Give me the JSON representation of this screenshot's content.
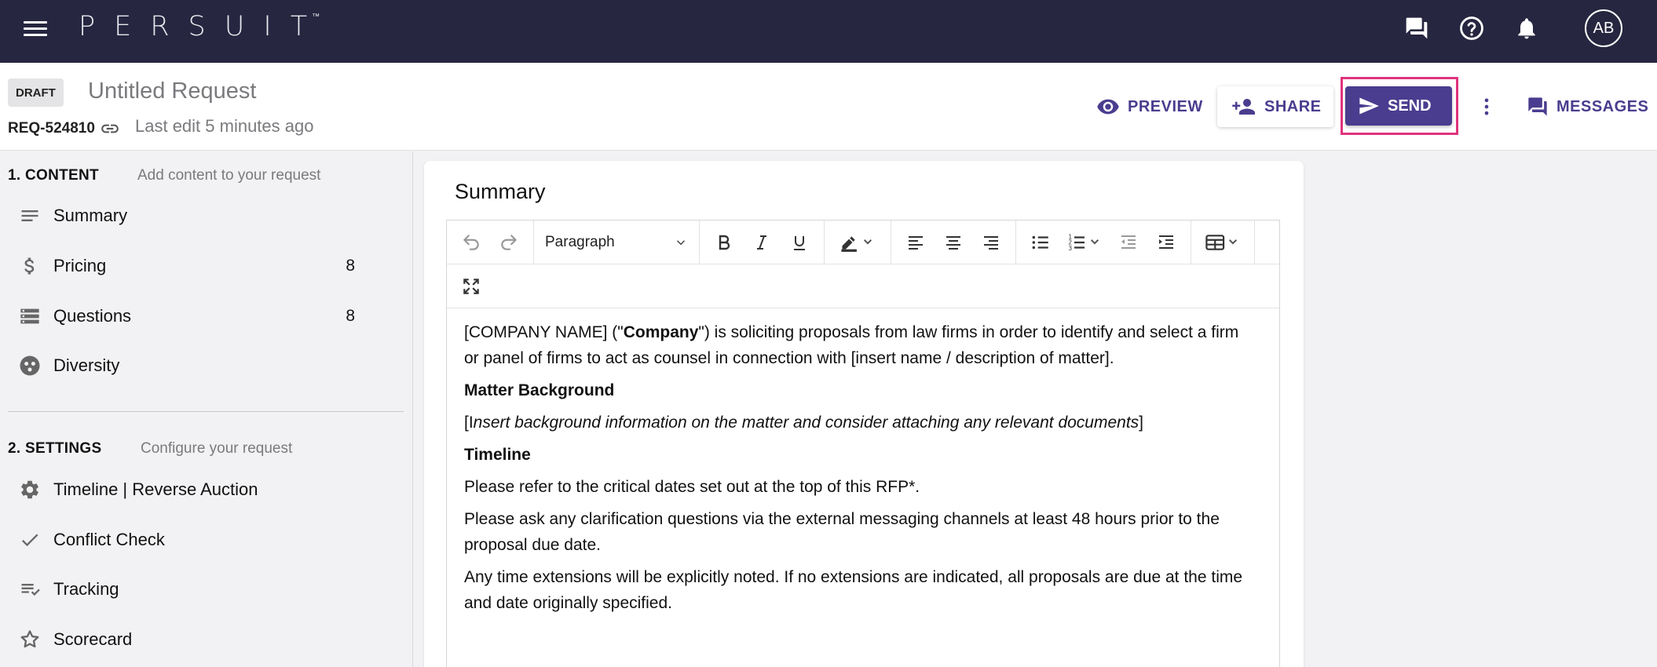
{
  "topbar": {
    "logo": "PERSUIT",
    "logo_tm": "™",
    "avatar": "AB",
    "icons": [
      "hamburger-menu-icon",
      "chat-icon",
      "help-icon",
      "bell-icon"
    ]
  },
  "header": {
    "status": "DRAFT",
    "title": "Untitled Request",
    "request_id": "REQ-524810",
    "last_edit": "Last edit 5 minutes ago",
    "preview_label": "PREVIEW",
    "share_label": "SHARE",
    "send_label": "SEND",
    "messages_label": "MESSAGES"
  },
  "sidebar": {
    "content_section": {
      "title": "1. CONTENT",
      "subtitle": "Add content to your request"
    },
    "content_items": [
      {
        "label": "Summary",
        "icon": "notes-icon",
        "count": ""
      },
      {
        "label": "Pricing",
        "icon": "dollar-icon",
        "count": "8"
      },
      {
        "label": "Questions",
        "icon": "storage-icon",
        "count": "8"
      },
      {
        "label": "Diversity",
        "icon": "diversity-icon",
        "count": ""
      }
    ],
    "settings_section": {
      "title": "2. SETTINGS",
      "subtitle": "Configure your request"
    },
    "settings_items": [
      {
        "label": "Timeline | Reverse Auction",
        "icon": "gear-icon"
      },
      {
        "label": "Conflict Check",
        "icon": "check-icon"
      },
      {
        "label": "Tracking",
        "icon": "checklist-icon"
      },
      {
        "label": "Scorecard",
        "icon": "star-icon"
      }
    ]
  },
  "editor": {
    "section_title": "Summary",
    "block_format": "Paragraph",
    "paragraphs": {
      "p1_a": "[COMPANY NAME] (\"",
      "p1_b": "Company",
      "p1_c": "\") is soliciting proposals from law firms in order to identify and select a firm or panel of firms to act as counsel in connection with [insert name / description of matter].",
      "h1": "Matter Background",
      "p2_a": "[I",
      "p2_b": "nsert background information on the matter and consider attaching any relevant documents",
      "p2_c": "]",
      "h2": "Timeline",
      "p3": "Please refer to the critical dates set out at the top of this RFP*.",
      "p4": "Please ask any clarification questions via the external messaging channels at least 48 hours prior to the proposal due date.",
      "p5": "Any time extensions will be explicitly noted. If no extensions are indicated, all proposals are due at the time and date originally specified."
    }
  },
  "colors": {
    "topbar": "#272640",
    "accent": "#4a3d8f",
    "highlight": "#e0337d"
  }
}
